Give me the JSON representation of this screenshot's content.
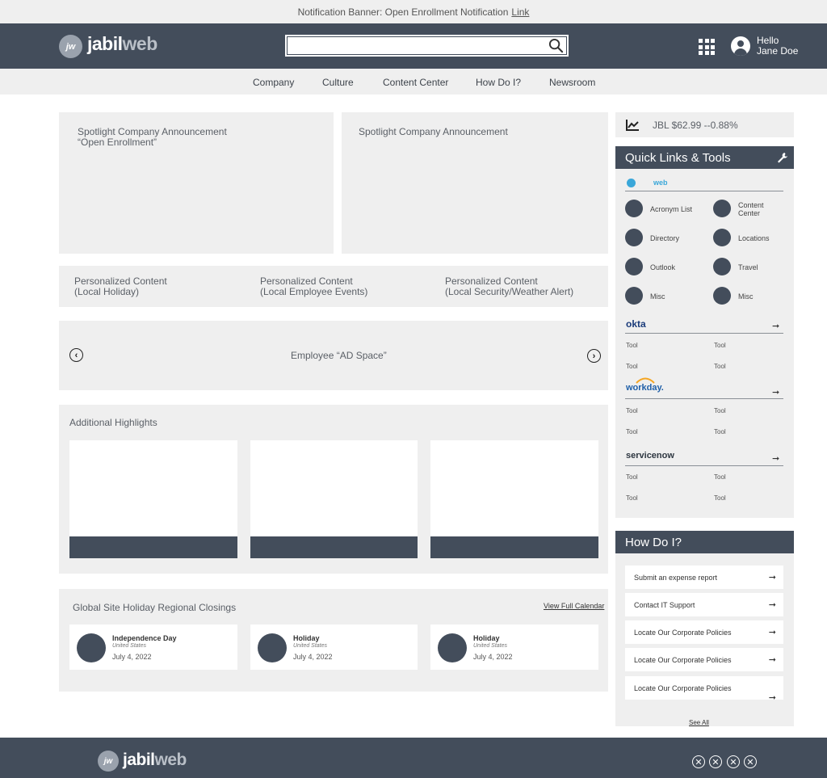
{
  "banner": {
    "text": "Notification Banner: Open Enrollment Notification",
    "link": "Link"
  },
  "header": {
    "logo_mark": "jw",
    "logo_name_a": "jabil",
    "logo_name_b": "web",
    "search_placeholder": "",
    "greeting_line1": "Hello",
    "greeting_line2": "Jane Doe"
  },
  "nav": {
    "items": [
      "Company",
      "Culture",
      "Content Center",
      "How Do I?",
      "Newsroom"
    ]
  },
  "spotlight": [
    {
      "line1": "Spotlight Company Announcement",
      "line2": "“Open Enrollment”"
    },
    {
      "line1": "Spotlight Company Announcement",
      "line2": ""
    }
  ],
  "personalized": [
    {
      "line1": "Personalized Content",
      "line2": "(Local Holiday)"
    },
    {
      "line1": "Personalized Content",
      "line2": "(Local Employee Events)"
    },
    {
      "line1": "Personalized Content",
      "line2": "(Local Security/Weather Alert)"
    }
  ],
  "ad_space": {
    "label": "Employee “AD Space”",
    "prev_icon": "‹",
    "next_icon": "›"
  },
  "highlights": {
    "title": "Additional Highlights"
  },
  "holidays": {
    "title": "Global Site Holiday Regional Closings",
    "link": "View Full Calendar",
    "items": [
      {
        "name": "Independence Day",
        "location": "United States",
        "date": "July 4, 2022"
      },
      {
        "name": "Holiday",
        "location": "United States",
        "date": "July 4, 2022"
      },
      {
        "name": "Holiday",
        "location": "United States",
        "date": "July 4, 2022"
      }
    ]
  },
  "stock": {
    "text": "JBL $62.99  --0.88%"
  },
  "quick_links": {
    "title": "Quick Links & Tools",
    "jabilweb_label": "web",
    "tools": [
      "Acronym List",
      "Content Center",
      "Directory",
      "Locations",
      "Outlook",
      "Travel",
      "Misc",
      "Misc"
    ],
    "okta": {
      "name": "okta",
      "tools": [
        "Tool",
        "Tool",
        "Tool",
        "Tool"
      ]
    },
    "workday": {
      "name": "workday.",
      "tools": [
        "Tool",
        "Tool",
        "Tool",
        "Tool"
      ]
    },
    "servicenow": {
      "name": "servicenow",
      "tools": [
        "Tool",
        "Tool",
        "Tool",
        "Tool"
      ]
    },
    "arrow": "➞"
  },
  "how_do_i": {
    "title": "How Do I?",
    "items": [
      "Submit an expense report",
      "Contact IT Support",
      "Locate Our Corporate Policies",
      "Locate Our Corporate Policies",
      "Locate Our Corporate Policies"
    ],
    "arrow": "➞",
    "see_all": "See All"
  },
  "footer": {
    "logo_mark": "jw",
    "logo_name_a": "jabil",
    "logo_name_b": "web",
    "social_icon": "✕"
  },
  "colors": {
    "dark": "#434d5b",
    "panel": "#efefef",
    "accent": "#3aa7d9"
  }
}
